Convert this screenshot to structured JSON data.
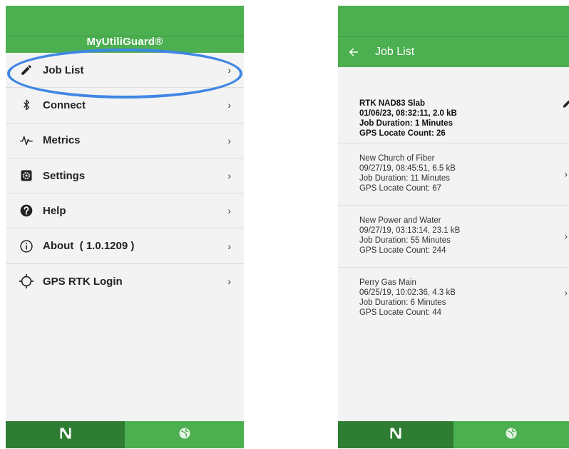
{
  "left_screen": {
    "app_title": "MyUtiliGuard®",
    "menu": [
      {
        "label": "Job List",
        "icon": "pencil-icon"
      },
      {
        "label": "Connect",
        "icon": "bluetooth-icon"
      },
      {
        "label": "Metrics",
        "icon": "pulse-icon"
      },
      {
        "label": "Settings",
        "icon": "settings-icon"
      },
      {
        "label": "Help",
        "icon": "help-icon"
      },
      {
        "label": "About  ( 1.0.1209 )",
        "icon": "info-icon"
      },
      {
        "label": "GPS RTK Login",
        "icon": "crosshair-icon"
      }
    ],
    "chevron": "›",
    "bottom_tabs": [
      {
        "icon": "utiliguard-logo-icon",
        "active": true
      },
      {
        "icon": "globe-icon",
        "active": false
      }
    ]
  },
  "right_screen": {
    "title": "Job List",
    "jobs": [
      {
        "name": "RTK NAD83 Slab",
        "date_size": "01/06/23, 08:32:11, 2.0 kB",
        "duration": "Job Duration: 1 Minutes",
        "gps_count": "GPS Locate Count: 26",
        "selected": true
      },
      {
        "name": "New Church of Fiber",
        "date_size": "09/27/19, 08:45:51, 6.5 kB",
        "duration": "Job Duration: 11 Minutes",
        "gps_count": "GPS Locate Count: 67",
        "selected": false
      },
      {
        "name": "New Power and Water",
        "date_size": "09/27/19, 03:13:14, 23.1 kB",
        "duration": "Job Duration: 55 Minutes",
        "gps_count": "GPS Locate Count: 244",
        "selected": false
      },
      {
        "name": "Perry Gas Main",
        "date_size": "06/25/19, 10:02:36, 4.3 kB",
        "duration": "Job Duration: 6 Minutes",
        "gps_count": "GPS Locate Count: 44",
        "selected": false
      }
    ],
    "chevron": "›"
  },
  "colors": {
    "primary_green": "#4caf50",
    "dark_green": "#2e7d32",
    "highlight_blue": "#3f86e4",
    "background": "#f3f3f3"
  }
}
